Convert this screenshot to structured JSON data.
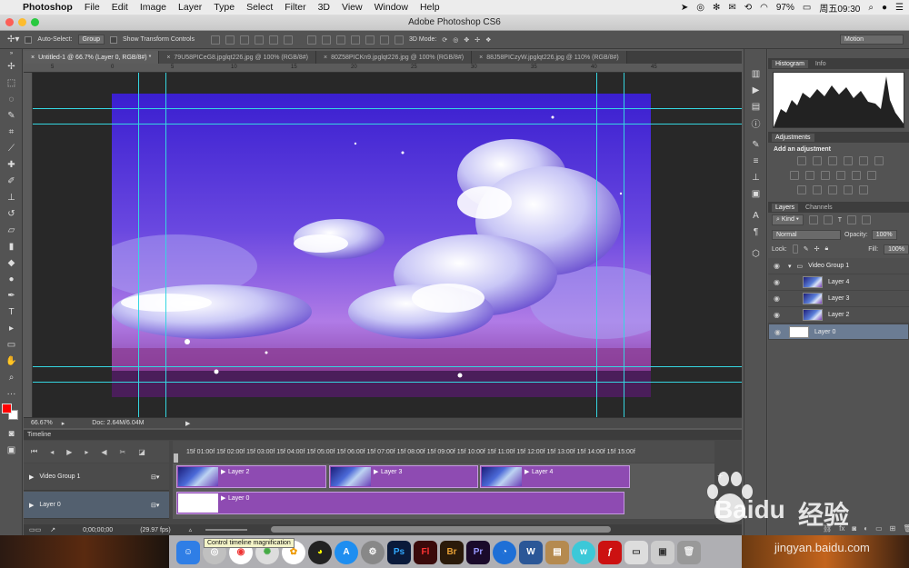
{
  "menubar": {
    "app_name": "Photoshop",
    "items": [
      "File",
      "Edit",
      "Image",
      "Layer",
      "Type",
      "Select",
      "Filter",
      "3D",
      "View",
      "Window",
      "Help"
    ],
    "battery": "97%",
    "clock": "周五09:30"
  },
  "window": {
    "title": "Adobe Photoshop CS6"
  },
  "options": {
    "auto_select_label": "Auto-Select:",
    "auto_select_value": "Group",
    "show_transform_label": "Show Transform Controls",
    "mode_3d_label": "3D Mode:",
    "workspace": "Motion"
  },
  "tabs": [
    {
      "label": "Untitled-1 @ 66.7% (Layer 0, RGB/8#) *"
    },
    {
      "label": "79U58PICeG8.jpglqt226.jpg @ 100% (RGB/8#)"
    },
    {
      "label": "80Z58PICKn9.jpglqt226.jpg @ 100% (RGB/8#)"
    },
    {
      "label": "88J58PICzyW.jpglqt226.jpg @ 110% (RGB/8#)"
    }
  ],
  "ruler_top_ticks": [
    "5",
    "0",
    "5",
    "10",
    "15",
    "20",
    "25",
    "30",
    "35",
    "40",
    "45"
  ],
  "status": {
    "zoom": "66.67%",
    "doc": "Doc: 2.64M/6.04M"
  },
  "timeline": {
    "title": "Timeline",
    "ruler": "15f 01:00f 15f 02:00f 15f 03:00f 15f 04:00f 15f 05:00f 15f 06:00f 15f 07:00f 15f 08:00f 15f 09:00f 15f 10:00f 15f 11:00f 15f 12:00f 15f 13:00f 15f 14:00f 15f 15:00f",
    "tracks": [
      {
        "label": "Video Group 1",
        "clips": [
          "Layer 2",
          "Layer 3",
          "Layer 4"
        ]
      },
      {
        "label": "Layer 0",
        "clips": [
          "Layer 0"
        ]
      }
    ],
    "timecode": "0;00;00;00",
    "fps": "(29.97 fps)"
  },
  "panels": {
    "histogram_tabs": [
      "Histogram",
      "Info"
    ],
    "adjustments_tab": "Adjustments",
    "add_adjustment": "Add an adjustment",
    "layers_tabs": [
      "Layers",
      "Channels"
    ],
    "kind": "Kind",
    "blend_mode": "Normal",
    "opacity_label": "Opacity:",
    "opacity_value": "100%",
    "lock_label": "Lock:",
    "fill_label": "Fill:",
    "fill_value": "100%",
    "layers": [
      {
        "name": "Video Group 1",
        "type": "group"
      },
      {
        "name": "Layer 4",
        "type": "layer"
      },
      {
        "name": "Layer 3",
        "type": "layer"
      },
      {
        "name": "Layer 2",
        "type": "layer"
      },
      {
        "name": "Layer 0",
        "type": "layer",
        "selected": true
      }
    ]
  },
  "tooltip": "Control timeline magnification",
  "watermark": {
    "brand": "Baidu",
    "cn": "经验",
    "url": "jingyan.baidu.com"
  },
  "colors": {
    "guide": "#35d6e0",
    "clip": "#8e4bb2",
    "foreground": "#ff0000",
    "background": "#ffffff"
  }
}
